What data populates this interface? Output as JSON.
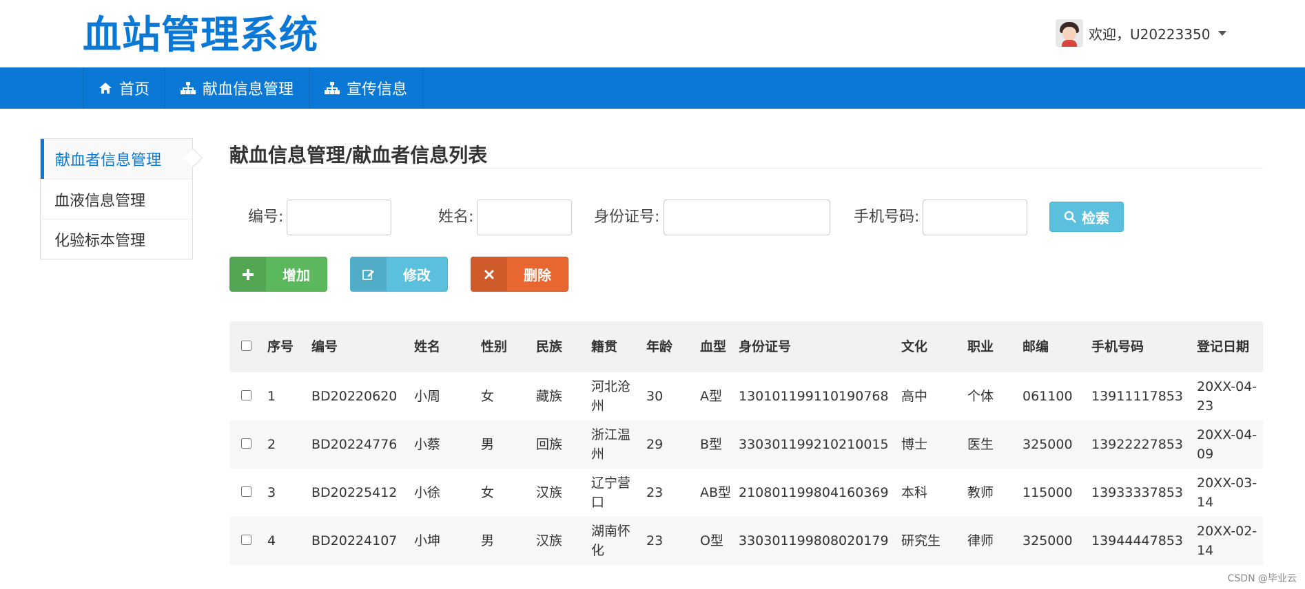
{
  "header": {
    "logo": "血站管理系统",
    "user_greeting": "欢迎，U20223350"
  },
  "nav": {
    "items": [
      {
        "label": "首页",
        "icon": "home-icon"
      },
      {
        "label": "献血信息管理",
        "icon": "sitemap-icon"
      },
      {
        "label": "宣传信息",
        "icon": "sitemap-icon"
      }
    ]
  },
  "sidebar": {
    "items": [
      {
        "label": "献血者信息管理",
        "active": true
      },
      {
        "label": "血液信息管理",
        "active": false
      },
      {
        "label": "化验标本管理",
        "active": false
      }
    ]
  },
  "main": {
    "title": "献血信息管理/献血者信息列表"
  },
  "search": {
    "id_label": "编号:",
    "name_label": "姓名:",
    "idcard_label": "身份证号:",
    "phone_label": "手机号码:",
    "button_label": "检索"
  },
  "actions": {
    "add": "增加",
    "edit": "修改",
    "delete": "删除"
  },
  "table": {
    "headers": [
      "序号",
      "编号",
      "姓名",
      "性别",
      "民族",
      "籍贯",
      "年龄",
      "血型",
      "身份证号",
      "文化",
      "职业",
      "邮编",
      "手机号码",
      "登记日期"
    ],
    "rows": [
      [
        "1",
        "BD20220620",
        "小周",
        "女",
        "藏族",
        "河北沧州",
        "30",
        "A型",
        "130101199110190768",
        "高中",
        "个体",
        "061100",
        "13911117853",
        "20XX-04-23"
      ],
      [
        "2",
        "BD20224776",
        "小蔡",
        "男",
        "回族",
        "浙江温州",
        "29",
        "B型",
        "330301199210210015",
        "博士",
        "医生",
        "325000",
        "13922227853",
        "20XX-04-09"
      ],
      [
        "3",
        "BD20225412",
        "小徐",
        "女",
        "汉族",
        "辽宁营口",
        "23",
        "AB型",
        "210801199804160369",
        "本科",
        "教师",
        "115000",
        "13933337853",
        "20XX-03-14"
      ],
      [
        "4",
        "BD20224107",
        "小坤",
        "男",
        "汉族",
        "湖南怀化",
        "23",
        "O型",
        "330301199808020179",
        "研究生",
        "律师",
        "325000",
        "13944447853",
        "20XX-02-14"
      ]
    ]
  },
  "watermark": "CSDN @毕业云",
  "colors": {
    "brand": "#0a78d4",
    "success": "#5cb85c",
    "info": "#5bc0de",
    "danger": "#e8662f"
  }
}
